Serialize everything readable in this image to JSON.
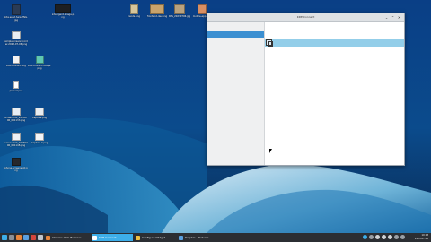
{
  "desktop": {
    "icons": [
      {
        "label": "kde.send.here.PNG.jpg",
        "color": "#2a3b55"
      },
      {
        "label": "simplescreenrecorder-2023-07-06.png",
        "color": "#e9edf2"
      },
      {
        "label": "kde-connect.png",
        "color": "#f2f2f2"
      },
      {
        "label": "kde-connect-image.png",
        "color": "#5fc7b2"
      },
      {
        "label": "pinned.png",
        "color": "#ffffff"
      },
      {
        "label": "screenshot_20230706_091133.png",
        "color": "#e8eef4"
      },
      {
        "label": "Capture.png",
        "color": "#e6ecf1"
      },
      {
        "label": "screenshot_20230706_091148.png",
        "color": "#edf1f5"
      },
      {
        "label": "Capture-2.png",
        "color": "#f3f5f7"
      },
      {
        "label": "phone-screenshot.png",
        "color": "#26282c"
      },
      {
        "label": "intelligent-image.png",
        "color": "#1d1f22"
      },
      {
        "label": "trends.png",
        "color": "#d6c59a"
      },
      {
        "label": "frontend-dev.png",
        "color": "#c9a36b"
      },
      {
        "label": "IMG_20230706.jpg",
        "color": "#b9a27e"
      },
      {
        "label": "mobile-app.png",
        "color": "#d88f63"
      },
      {
        "label": "Sea-Wave.png",
        "color": "#5a6d80"
      }
    ]
  },
  "window": {
    "title": "KDE Connect",
    "controls": {
      "minimize": "⌄",
      "maximize": "⌃",
      "close": "✕"
    },
    "sidebar_selected_label": "",
    "device_row": {
      "icon": "device-icon"
    }
  },
  "taskbar": {
    "tasks": [
      {
        "label": "Firefox"
      },
      {
        "label": "Chrome Web Browser"
      },
      {
        "label": "KDE Connect"
      },
      {
        "label": "Configure Widget"
      },
      {
        "label": "Dolphin - Pictures"
      }
    ],
    "clock_time": "10:18",
    "clock_date": "2023-07-06"
  },
  "colors": {
    "accent": "#3daee9",
    "sidebar_selected": "#3b8fd1",
    "device_row": "#93cee9",
    "taskbar": "#2b2e33"
  }
}
